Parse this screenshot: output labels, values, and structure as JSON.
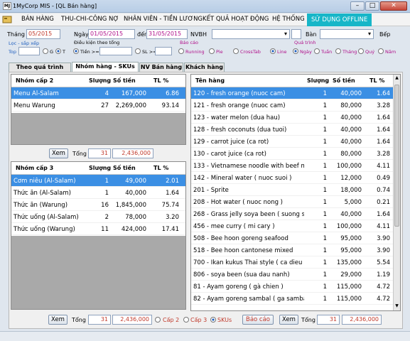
{
  "window": {
    "app_icon": "MJ",
    "title": "1MyCorp MIS - [QL Bán hàng]",
    "min": "–",
    "max": "□",
    "close": "✕"
  },
  "menu": {
    "items": [
      "BÁN HÀNG",
      "THU-CHI-CÔNG NỢ",
      "NHÂN VIÊN - TIỀN LƯƠNG",
      "KẾT QUẢ HOẠT ĐỘNG",
      "HỆ THỐNG"
    ],
    "active": "SỬ DỤNG OFFLINE"
  },
  "filters": {
    "thang_label": "Tháng",
    "thang_value": "05/2015",
    "ngay_label": "Ngày",
    "ngay_value": "01/05/2015",
    "den_label": "đến",
    "den_value": "31/05/2015",
    "nvbh_label": "NVBH",
    "ban_label": "Bàn",
    "bep_label": "Bếp",
    "loc_sapxep_label": "Lọc - sắp xếp",
    "top_label": "Top",
    "g_label": "G",
    "t_label": "T",
    "dieukien_label": "Điều kiện theo tổng",
    "tien_label": "Tiền >=",
    "sl_label": "SL >=",
    "baocao_label": "Báo cáo",
    "report_types": [
      "Running",
      "Pie",
      "CrossTab",
      "Line"
    ],
    "quatrinh_label": "Quá trình",
    "periods": [
      "Ngày",
      "Tuần",
      "Tháng",
      "Quý",
      "Năm"
    ]
  },
  "tabs": [
    "Theo quá trình",
    "Nhóm hàng - SKUs",
    "NV Bán hàng",
    "Khách hàng"
  ],
  "grid_cap2": {
    "headers": [
      "Nhóm cấp 2",
      "Slượng",
      "Số tiền",
      "TL %"
    ],
    "rows": [
      [
        "Menu Al-Salam",
        "4",
        "167,000",
        "6.86"
      ],
      [
        "Menu Warung",
        "27",
        "2,269,000",
        "93.14"
      ]
    ]
  },
  "cap2_footer": {
    "xem": "Xem",
    "tong": "Tổng",
    "qty": "31",
    "amount": "2,436,000"
  },
  "grid_cap3": {
    "headers": [
      "Nhóm cấp 3",
      "Slượng",
      "Số tiền",
      "TL %"
    ],
    "rows": [
      [
        "Cơm niêu (Al-Salam)",
        "1",
        "49,000",
        "2.01"
      ],
      [
        "Thức ăn (Al-Salam)",
        "1",
        "40,000",
        "1.64"
      ],
      [
        "Thức ăn (Warung)",
        "16",
        "1,845,000",
        "75.74"
      ],
      [
        "Thức uống (Al-Salam)",
        "2",
        "78,000",
        "3.20"
      ],
      [
        "Thức uống (Warung)",
        "11",
        "424,000",
        "17.41"
      ]
    ]
  },
  "grid_items": {
    "headers": [
      "Tên hàng",
      "Slượng",
      "Số tiền",
      "TL %"
    ],
    "rows": [
      [
        "120 - fresh orange (nuoc cam)",
        "1",
        "40,000",
        "1.64"
      ],
      [
        "121 - fresh orange (nuoc cam)",
        "1",
        "80,000",
        "3.28"
      ],
      [
        "123 - water melon (dua hau)",
        "1",
        "40,000",
        "1.64"
      ],
      [
        "128 - fresh coconuts (dua tuoi)",
        "1",
        "40,000",
        "1.64"
      ],
      [
        "129 - carrot juice (ca rot)",
        "1",
        "40,000",
        "1.64"
      ],
      [
        "130 - carot juice (ca rot)",
        "1",
        "80,000",
        "3.28"
      ],
      [
        "133 - Vietnamese noodle with beef me...",
        "1",
        "100,000",
        "4.11"
      ],
      [
        "142 - Mineral water ( nuoc suoi )",
        "1",
        "12,000",
        "0.49"
      ],
      [
        "201 - Sprite",
        "1",
        "18,000",
        "0.74"
      ],
      [
        "208 - Hot water ( nuoc nong )",
        "1",
        "5,000",
        "0.21"
      ],
      [
        "268 - Grass jelly soya been ( suong sa...",
        "1",
        "40,000",
        "1.64"
      ],
      [
        "456 - mee curry ( mi cary )",
        "1",
        "100,000",
        "4.11"
      ],
      [
        "508 - Bee hoon goreng seafood",
        "1",
        "95,000",
        "3.90"
      ],
      [
        "518 - Bee hoon cantonese mixed",
        "1",
        "95,000",
        "3.90"
      ],
      [
        "700 - Ikan kukus Thai style ( ca dieu ho...",
        "1",
        "135,000",
        "5.54"
      ],
      [
        "806 - soya been (sua dau nanh)",
        "1",
        "29,000",
        "1.19"
      ],
      [
        "81 - Ayam goreng ( gà chien )",
        "1",
        "115,000",
        "4.72"
      ],
      [
        "82 - Ayam goreng sambal ( ga sambal )",
        "1",
        "115,000",
        "4.72"
      ]
    ]
  },
  "bottom": {
    "xem": "Xem",
    "tong": "Tổng",
    "qty": "31",
    "amount": "2,436,000",
    "levels": [
      "Cấp 2",
      "Cấp 3",
      "SKUs"
    ],
    "baocao": "Báo cáo",
    "xem2": "Xem",
    "tong2": "Tổng",
    "qty2": "31",
    "amount2": "2,436,000"
  },
  "colors": {
    "selected_row": "#3b8fe4",
    "offline_menu": "#17b6c8",
    "value_red": "#c0392b"
  }
}
